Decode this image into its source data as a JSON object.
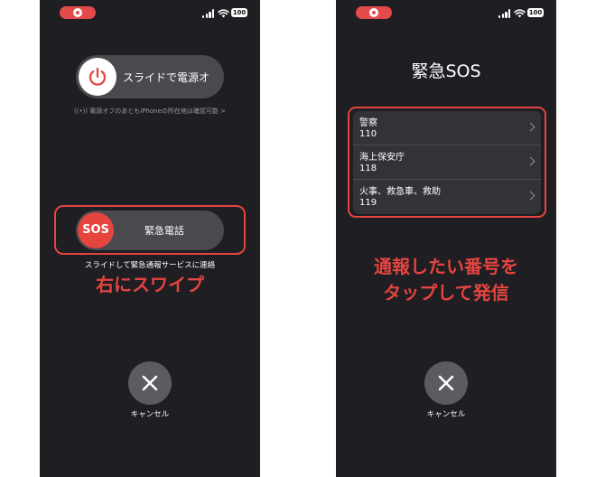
{
  "left_screen": {
    "battery": "100",
    "power_slider_label": "スライドで電源オフ",
    "find_my_note": "((•)) 電源オフのあともiPhoneの所在地は確認可能 >",
    "sos_knob": "SOS",
    "sos_slider_label": "緊急電話",
    "sos_hint": "スライドして緊急通報サービスに連絡",
    "caption": "右にスワイプ",
    "cancel_label": "キャンセル"
  },
  "right_screen": {
    "battery": "100",
    "title": "緊急SOS",
    "contacts": [
      {
        "name": "警察",
        "number": "110"
      },
      {
        "name": "海上保安庁",
        "number": "118"
      },
      {
        "name": "火事、救急車、救助",
        "number": "119"
      }
    ],
    "caption_line1": "通報したい番号を",
    "caption_line2": "タップして発信",
    "cancel_label": "キャンセル"
  },
  "icons": [
    "record-icon",
    "signal-icon",
    "wifi-icon",
    "battery-icon",
    "power-icon",
    "chevron-right-icon",
    "close-icon"
  ],
  "colors": {
    "accent_red": "#e5443f",
    "background": "#1f1e22",
    "slider": "#4a4a4e",
    "list": "#333337"
  }
}
